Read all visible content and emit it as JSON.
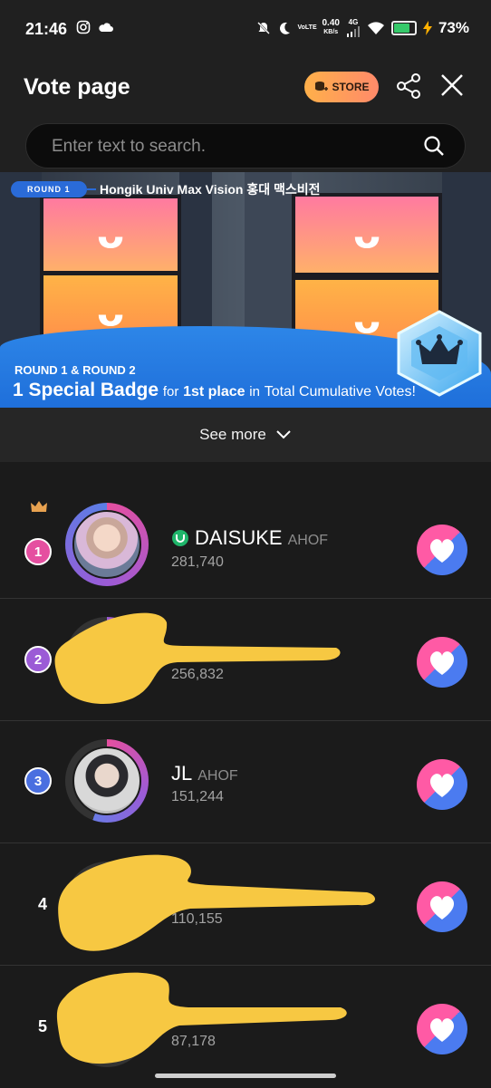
{
  "status": {
    "time": "21:46",
    "data_rate": "0.40",
    "data_unit": "KB/s",
    "network": "4G",
    "volte": "VoLTE",
    "battery": "73%"
  },
  "header": {
    "title": "Vote page",
    "store_label": "STORE"
  },
  "search": {
    "placeholder": "Enter text to search."
  },
  "banner": {
    "round_tag": "ROUND 1",
    "title": "Hongik Univ Max Vision 홍대 맥스비전",
    "subtitle": "ROUND 1 & ROUND 2",
    "main_big": "1 Special Badge",
    "main_mid1": "for",
    "main_bold": "1st place",
    "main_mid2": "in",
    "main_bold2": "Total Cumulative Votes!"
  },
  "see_more": {
    "label": "See more"
  },
  "ranking": [
    {
      "rank": "1",
      "name": "DAISUKE",
      "group": "AHOF",
      "votes": "281,740"
    },
    {
      "rank": "2",
      "name": "",
      "group": "",
      "votes": "256,832"
    },
    {
      "rank": "3",
      "name": "JL",
      "group": "AHOF",
      "votes": "151,244"
    },
    {
      "rank": "4",
      "name": "",
      "group": "",
      "votes": "110,155"
    },
    {
      "rank": "5",
      "name": "",
      "group": "",
      "votes": "87,178"
    }
  ],
  "colors": {
    "rank1": "#e54fa0",
    "rank2": "#9b5bd6",
    "rank3": "#4a6fe0",
    "vote_pink": "#ff5aa5",
    "vote_blue": "#4b7bf0",
    "scribble": "#f7c842",
    "store": "#ffa35a"
  }
}
